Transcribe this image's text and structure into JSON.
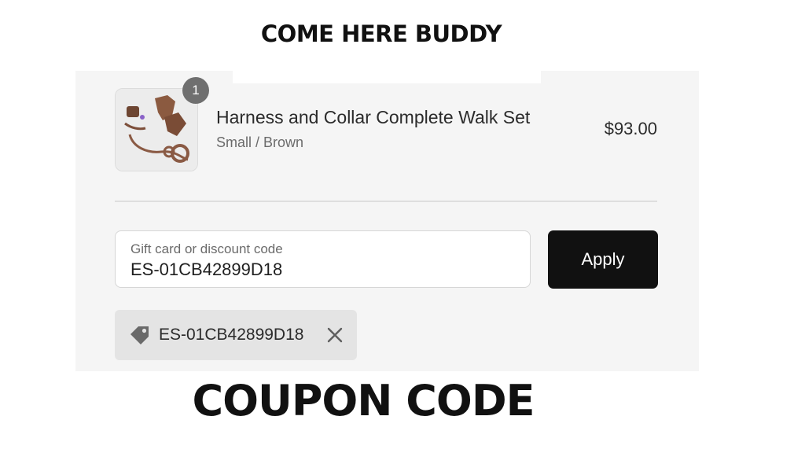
{
  "brand": {
    "title": "COME HERE BUDDY"
  },
  "cart_item": {
    "quantity": "1",
    "title": "Harness and Collar Complete Walk Set",
    "variant": "Small / Brown",
    "price": "$93.00",
    "image_icon": "product-thumbnail"
  },
  "discount": {
    "field_label": "Gift card or discount code",
    "field_value": "ES-01CB42899D18",
    "apply_label": "Apply"
  },
  "applied_code": {
    "code": "ES-01CB42899D18",
    "tag_icon": "tag-icon",
    "remove_icon": "close-icon"
  },
  "caption": {
    "text": "COUPON CODE"
  },
  "colors": {
    "panel_bg": "#f5f5f5",
    "button_bg": "#111111",
    "tag_bg": "#e4e4e4",
    "badge_bg": "#6f6f6f"
  }
}
